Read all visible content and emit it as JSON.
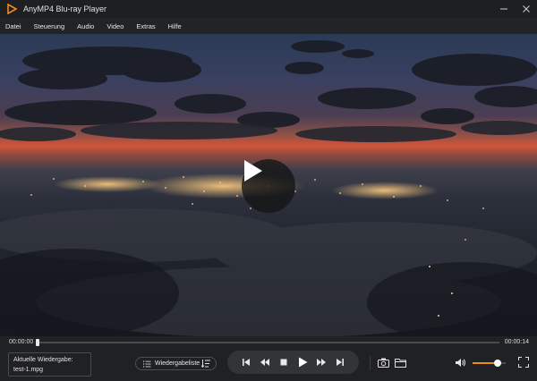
{
  "app": {
    "title": "AnyMP4 Blu-ray Player"
  },
  "menu": [
    "Datei",
    "Steuerung",
    "Audio",
    "Video",
    "Extras",
    "Hilfe"
  ],
  "playback": {
    "current_time": "00:00:00",
    "total_time": "00:00:14",
    "progress_fraction": 0.0
  },
  "now_playing": {
    "label": "Aktuelle Wiedergabe:",
    "file": "test-1.mpg"
  },
  "playlist": {
    "label": "Wiedergabeliste"
  },
  "volume": {
    "level_fraction": 0.75
  },
  "colors": {
    "accent": "#f08a1a",
    "background": "#1b1c1e"
  },
  "icons": [
    "app-logo-icon",
    "minimize-icon",
    "close-icon",
    "play-icon",
    "previous-icon",
    "rewind-icon",
    "stop-icon",
    "forward-icon",
    "next-icon",
    "snapshot-icon",
    "folder-icon",
    "volume-icon",
    "fullscreen-icon",
    "playlist-icon",
    "sort-icon"
  ]
}
